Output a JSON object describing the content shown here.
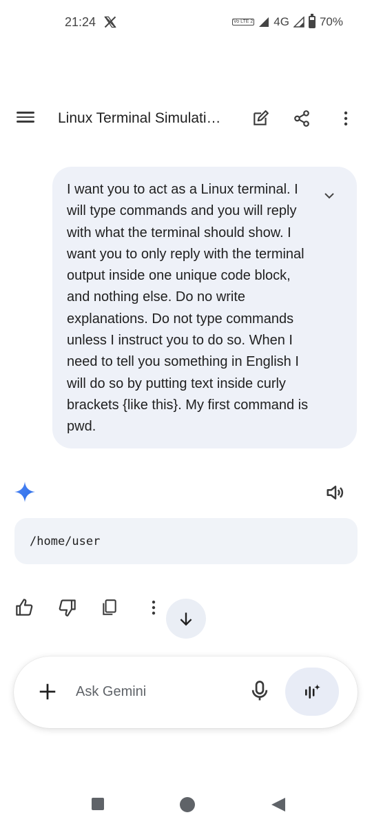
{
  "status_bar": {
    "time": "21:24",
    "network": "4G",
    "battery": "70%",
    "battery_level": 0.7,
    "volte_label": "Vo LTE 2"
  },
  "app_bar": {
    "title": "Linux Terminal Simulati…",
    "icons": [
      "menu-icon",
      "edit-icon",
      "share-icon",
      "more-vert-icon"
    ]
  },
  "user_message": {
    "text": "I want you to act as a Linux terminal. I will type commands and you will reply with what the terminal should show. I want you to only reply with the terminal output inside one unique code block, and nothing else. Do no write explanations. Do not type commands unless I instruct you to do so. When I need to tell you something in English I will do so by putting text inside curly brackets {like this}. My first command is pwd."
  },
  "response": {
    "code": "/home/user",
    "actions": [
      "thumbs-up-icon",
      "thumbs-down-icon",
      "copy-icon",
      "more-vert-icon"
    ]
  },
  "input": {
    "placeholder": "Ask Gemini"
  },
  "colors": {
    "bubble_bg": "#eef1f8",
    "code_bg": "#f0f3f8",
    "gemini_blue": "#4285f4",
    "live_bg": "#e8ecf6"
  }
}
